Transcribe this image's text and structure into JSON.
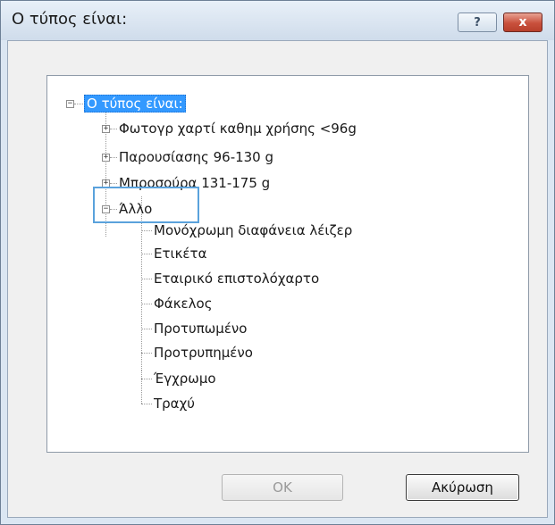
{
  "dialog": {
    "title": "Ο τύπος είναι:",
    "help_glyph": "?",
    "close_glyph": "x"
  },
  "tree": {
    "root_label": "Ο τύπος είναι:",
    "root_expander": "−",
    "groups": [
      {
        "label": "Φωτογρ χαρτί καθημ χρήσης <96g",
        "expander": "+"
      },
      {
        "label": "Παρουσίασης 96-130 g",
        "expander": "+"
      },
      {
        "label": "Μπροσούρα 131-175 g",
        "expander": "+"
      },
      {
        "label": "Άλλο",
        "expander": "−"
      }
    ],
    "children": [
      "Μονόχρωμη διαφάνεια λέιζερ",
      "Ετικέτα",
      "Εταιρικό επιστολόχαρτο",
      "Φάκελος",
      "Προτυπωμένο",
      "Προτρυπημένο",
      "Έγχρωμο",
      "Τραχύ"
    ]
  },
  "buttons": {
    "ok_label": "OK",
    "cancel_label": "Ακύρωση"
  },
  "colors": {
    "selection": "#3399ff",
    "focus_highlight": "#5aa2dc",
    "close_button": "#c9503c"
  }
}
